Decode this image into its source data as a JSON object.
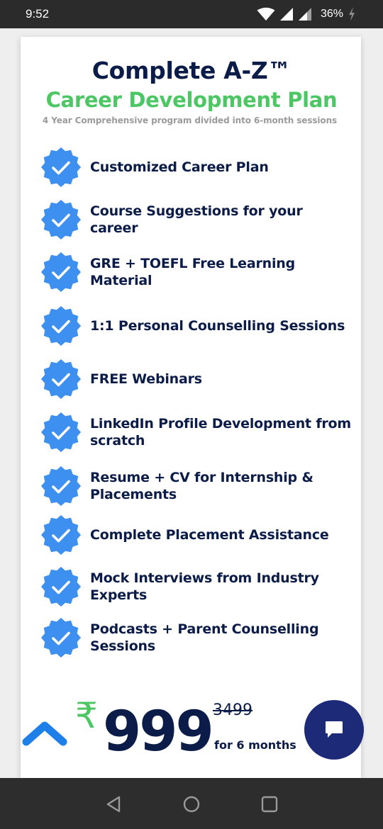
{
  "status_bar": {
    "time": "9:52",
    "battery": "36%",
    "icons": [
      "wifi-icon",
      "signal-icon",
      "signal-icon",
      "battery-charging-icon"
    ]
  },
  "header": {
    "title": "Complete A-Z™",
    "subtitle_colored": "Career Development Plan",
    "tagline": "4 Year Comprehensive program divided into 6-month sessions"
  },
  "features": [
    {
      "label": "Customized Career Plan"
    },
    {
      "label": "Course Suggestions for your career"
    },
    {
      "label": "GRE + TOEFL Free Learning Material"
    },
    {
      "label": "1:1 Personal Counselling Sessions"
    },
    {
      "label": "FREE Webinars"
    },
    {
      "label": "LinkedIn Profile Development from scratch"
    },
    {
      "label": "Resume + CV for Internship & Placements"
    },
    {
      "label": "Complete Placement Assistance"
    },
    {
      "label": "Mock Interviews from Industry Experts"
    },
    {
      "label": "Podcasts + Parent Counselling Sessions"
    }
  ],
  "pricing": {
    "currency_symbol": "₹",
    "price": "999",
    "old_price": "3499",
    "period": "for 6 months"
  },
  "colors": {
    "navy": "#0c1c48",
    "green": "#4cc764",
    "badge_blue": "#3d8ff0",
    "fab": "#1c2a78"
  },
  "icons": {
    "feature_badge": "verified-check-icon",
    "scroll_up": "chevron-up-icon",
    "chat": "chat-bubble-icon",
    "nav": [
      "back-triangle-icon",
      "home-circle-icon",
      "recents-square-icon"
    ]
  }
}
